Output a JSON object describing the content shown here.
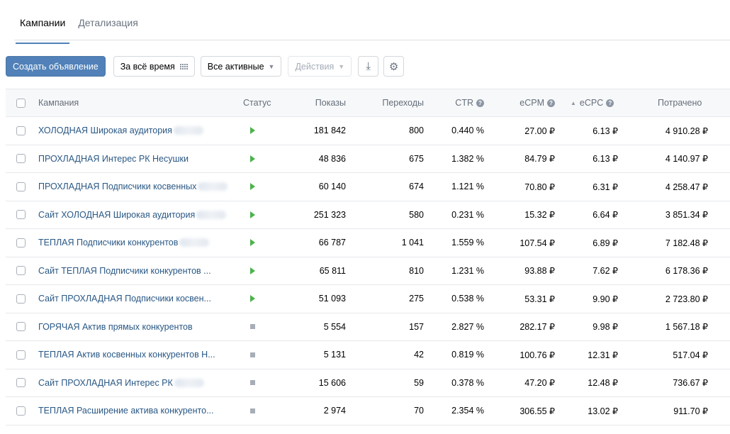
{
  "tabs": [
    {
      "label": "Кампании",
      "active": true
    },
    {
      "label": "Детализация",
      "active": false
    }
  ],
  "toolbar": {
    "create_label": "Создать объявление",
    "period_label": "За всё время",
    "filter_label": "Все активные",
    "actions_label": "Действия",
    "download_icon": "⤓",
    "settings_icon": "⚙"
  },
  "table": {
    "headers": {
      "campaign": "Кампания",
      "status": "Статус",
      "views": "Показы",
      "clicks": "Переходы",
      "ctr": "CTR",
      "ecpm": "eCPM",
      "ecpc": "eCPC",
      "spent": "Потрачено"
    },
    "sort_indicator": "▲",
    "rows": [
      {
        "name": "ХОЛОДНАЯ Широкая аудитория",
        "status": "active",
        "views": "181 842",
        "clicks": "800",
        "ctr": "0.440 %",
        "ecpm": "27.00 ₽",
        "ecpc": "6.13 ₽",
        "spent": "4 910.28 ₽",
        "redacted": true
      },
      {
        "name": "ПРОХЛАДНАЯ Интерес РК Несушки",
        "status": "active",
        "views": "48 836",
        "clicks": "675",
        "ctr": "1.382 %",
        "ecpm": "84.79 ₽",
        "ecpc": "6.13 ₽",
        "spent": "4 140.97 ₽",
        "redacted": false
      },
      {
        "name": "ПРОХЛАДНАЯ Подписчики косвенных",
        "status": "active",
        "views": "60 140",
        "clicks": "674",
        "ctr": "1.121 %",
        "ecpm": "70.80 ₽",
        "ecpc": "6.31 ₽",
        "spent": "4 258.47 ₽",
        "redacted": true
      },
      {
        "name": "Сайт ХОЛОДНАЯ Широкая аудитория",
        "status": "active",
        "views": "251 323",
        "clicks": "580",
        "ctr": "0.231 %",
        "ecpm": "15.32 ₽",
        "ecpc": "6.64 ₽",
        "spent": "3 851.34 ₽",
        "redacted": true
      },
      {
        "name": "ТЕПЛАЯ Подписчики конкурентов",
        "status": "active",
        "views": "66 787",
        "clicks": "1 041",
        "ctr": "1.559 %",
        "ecpm": "107.54 ₽",
        "ecpc": "6.89 ₽",
        "spent": "7 182.48 ₽",
        "redacted": true
      },
      {
        "name": "Сайт ТЕПЛАЯ Подписчики конкурентов ...",
        "status": "active",
        "views": "65 811",
        "clicks": "810",
        "ctr": "1.231 %",
        "ecpm": "93.88 ₽",
        "ecpc": "7.62 ₽",
        "spent": "6 178.36 ₽",
        "redacted": false
      },
      {
        "name": "Сайт ПРОХЛАДНАЯ Подписчики косвен...",
        "status": "active",
        "views": "51 093",
        "clicks": "275",
        "ctr": "0.538 %",
        "ecpm": "53.31 ₽",
        "ecpc": "9.90 ₽",
        "spent": "2 723.80 ₽",
        "redacted": false
      },
      {
        "name": "ГОРЯЧАЯ Актив прямых конкурентов",
        "status": "stopped",
        "views": "5 554",
        "clicks": "157",
        "ctr": "2.827 %",
        "ecpm": "282.17 ₽",
        "ecpc": "9.98 ₽",
        "spent": "1 567.18 ₽",
        "redacted": false
      },
      {
        "name": "ТЕПЛАЯ Актив косвенных конкурентов Н...",
        "status": "stopped",
        "views": "5 131",
        "clicks": "42",
        "ctr": "0.819 %",
        "ecpm": "100.76 ₽",
        "ecpc": "12.31 ₽",
        "spent": "517.04 ₽",
        "redacted": false
      },
      {
        "name": "Сайт ПРОХЛАДНАЯ Интерес РК",
        "status": "stopped",
        "views": "15 606",
        "clicks": "59",
        "ctr": "0.378 %",
        "ecpm": "47.20 ₽",
        "ecpc": "12.48 ₽",
        "spent": "736.67 ₽",
        "redacted": true
      },
      {
        "name": "ТЕПЛАЯ Расширение актива конкуренто...",
        "status": "stopped",
        "views": "2 974",
        "clicks": "70",
        "ctr": "2.354 %",
        "ecpm": "306.55 ₽",
        "ecpc": "13.02 ₽",
        "spent": "911.70 ₽",
        "redacted": false
      }
    ]
  },
  "colors": {
    "accent": "#5181b8",
    "link": "#2a5885",
    "status_active": "#4bb34b",
    "status_stopped": "#a8aeb7"
  }
}
